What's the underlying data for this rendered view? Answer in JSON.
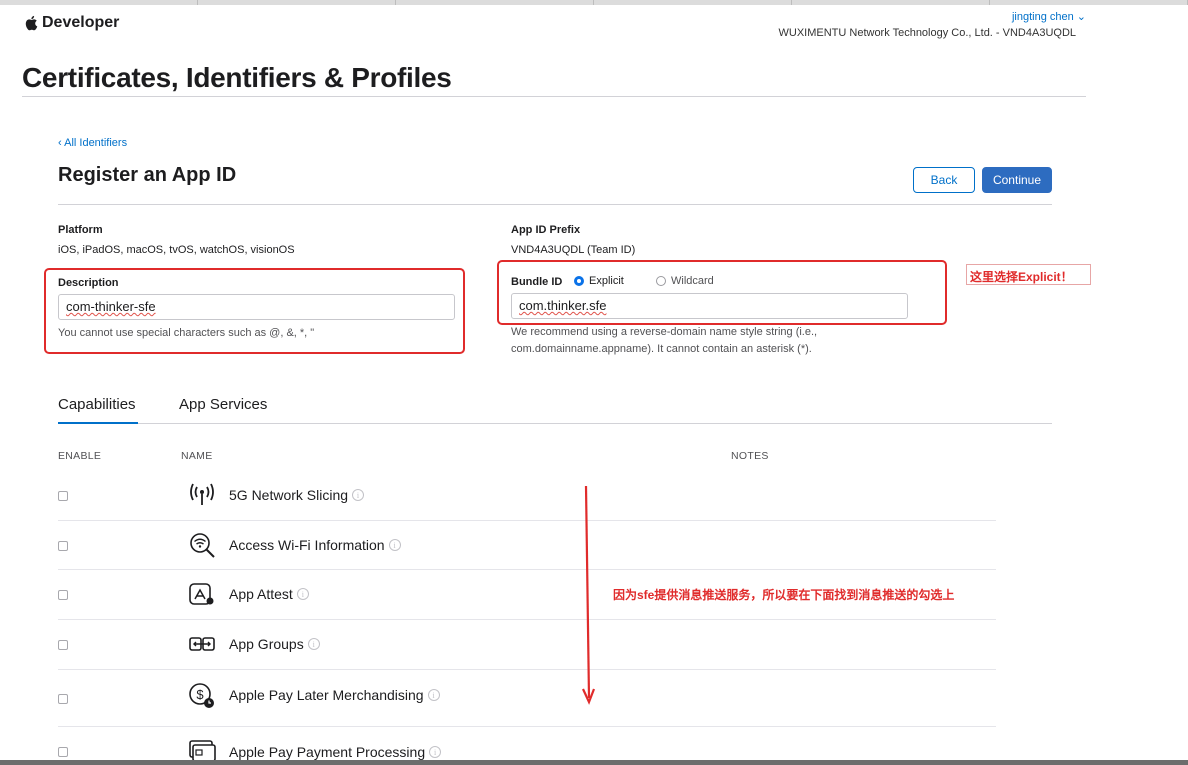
{
  "header": {
    "brand": "Developer",
    "user": "jingting chen ⌄",
    "team": "WUXIMENTU Network Technology Co., Ltd. - VND4A3UQDL"
  },
  "page": {
    "title": "Certificates, Identifiers & Profiles",
    "back_link": "‹ All Identifiers",
    "heading": "Register an App ID",
    "back_button": "Back",
    "continue_button": "Continue"
  },
  "form": {
    "platform_label": "Platform",
    "platform_value": "iOS, iPadOS, macOS, tvOS, watchOS, visionOS",
    "prefix_label": "App ID Prefix",
    "prefix_value": "VND4A3UQDL (Team ID)",
    "description_label": "Description",
    "description_value": "com-thinker-sfe",
    "description_help": "You cannot use special characters such as @, &, *, \"",
    "bundle_label": "Bundle ID",
    "radio_explicit": "Explicit",
    "radio_wildcard": "Wildcard",
    "bundle_value": "com.thinker.sfe",
    "bundle_help_1": "We recommend using a reverse-domain name style string (i.e.,",
    "bundle_help_2": "com.domainname.appname). It cannot contain an asterisk (*)."
  },
  "annotations": {
    "note_explicit": "这里选择Explicit！",
    "note_push": "因为sfe提供消息推送服务，所以要在下面找到消息推送的勾选上",
    "color": "#e02b2b"
  },
  "tabs": [
    "Capabilities",
    "App Services"
  ],
  "table": {
    "headers": [
      "ENABLE",
      "NAME",
      "NOTES"
    ],
    "rows": [
      {
        "name": "5G Network Slicing",
        "icon": "antenna-icon"
      },
      {
        "name": "Access Wi-Fi Information",
        "icon": "wifi-search-icon"
      },
      {
        "name": "App Attest",
        "icon": "app-attest-icon"
      },
      {
        "name": "App Groups",
        "icon": "app-groups-icon"
      },
      {
        "name": "Apple Pay Later Merchandising",
        "icon": "dollar-clock-icon"
      },
      {
        "name": "Apple Pay Payment Processing",
        "icon": "credit-card-icon"
      }
    ]
  },
  "colors": {
    "link": "#0070c9",
    "primary_button": "#2d6cc0",
    "highlight": "#e02b2b"
  }
}
